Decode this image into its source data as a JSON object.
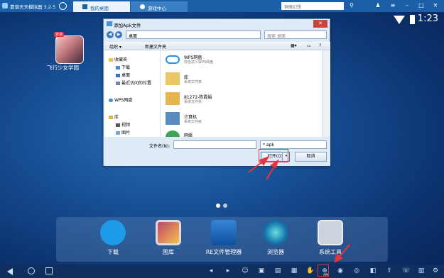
{
  "app": {
    "title": "靠谱天天模拟器 3.2.5"
  },
  "tabs": [
    {
      "label": "我的桌面"
    },
    {
      "label": "游戏中心"
    }
  ],
  "search": {
    "placeholder": "神魔幻想"
  },
  "status": {
    "time": "1:23"
  },
  "desktop": {
    "icon_label": "飞行少女学园",
    "icon_badge": "安卓"
  },
  "dock": [
    {
      "label": "下载"
    },
    {
      "label": "图库"
    },
    {
      "label": "RE文件管理器"
    },
    {
      "label": "浏览器"
    },
    {
      "label": "系统工具"
    }
  ],
  "bottom": {
    "apk_label": "APK"
  },
  "dialog": {
    "title": "添加Apk文件",
    "address": "桌面",
    "search_placeholder": "搜索 桌面",
    "toolbar": {
      "organize": "组织 ▾",
      "new_folder": "新建文件夹"
    },
    "nav": [
      "收藏夹",
      "下载",
      "桌面",
      "最近访问的位置",
      "WPS网盘",
      "库",
      "视频",
      "图片"
    ],
    "files": [
      {
        "name": "WPS网盘",
        "sub": "双击进入WPS网盘"
      },
      {
        "name": "库",
        "sub": "系统文件夹"
      },
      {
        "name": "81272-陈霞娟",
        "sub": "系统文件夹"
      },
      {
        "name": "计算机",
        "sub": "系统文件夹"
      },
      {
        "name": "网络",
        "sub": ""
      }
    ],
    "filename_label": "文件名(N):",
    "filter": "*.apk",
    "open_label": "打开(O)",
    "cancel_label": "取消"
  },
  "colors": {
    "titlebar": "#1b5fa8",
    "desktop": "#174e93",
    "dialog": "#dfeaf7",
    "highlight": "#e6363c"
  }
}
